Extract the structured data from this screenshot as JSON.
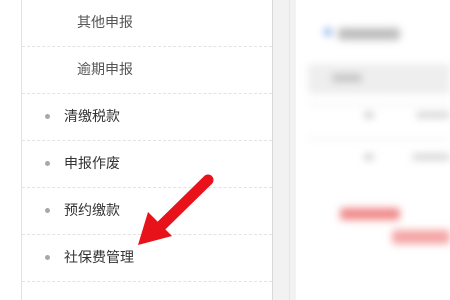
{
  "sidebar": {
    "items": [
      {
        "label": "其他申报",
        "level": "sub"
      },
      {
        "label": "逾期申报",
        "level": "sub"
      },
      {
        "label": "清缴税款",
        "level": "top"
      },
      {
        "label": "申报作废",
        "level": "top"
      },
      {
        "label": "预约缴款",
        "level": "top"
      },
      {
        "label": "社保费管理",
        "level": "top"
      }
    ]
  },
  "annotation": {
    "arrow_color": "#e8121b",
    "points_to": "社保费管理"
  }
}
